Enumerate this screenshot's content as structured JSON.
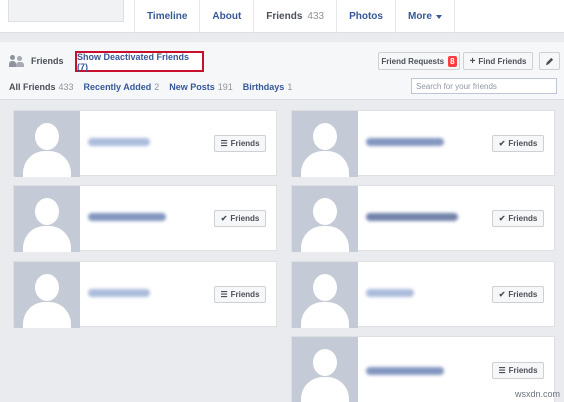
{
  "nav": {
    "tabs": [
      {
        "label": "Timeline",
        "count": ""
      },
      {
        "label": "About",
        "count": ""
      },
      {
        "label": "Friends",
        "count": "433"
      },
      {
        "label": "Photos",
        "count": ""
      },
      {
        "label": "More",
        "count": ""
      }
    ]
  },
  "header": {
    "title": "Friends",
    "deactivated_link": "Show Deactivated Friends (7)",
    "friend_requests_label": "Friend Requests",
    "friend_requests_count": "8",
    "find_friends_label": "Find Friends"
  },
  "subtabs": [
    {
      "label": "All Friends",
      "count": "433"
    },
    {
      "label": "Recently Added",
      "count": "2"
    },
    {
      "label": "New Posts",
      "count": "191"
    },
    {
      "label": "Birthdays",
      "count": "1"
    }
  ],
  "search": {
    "placeholder": "Search for your friends"
  },
  "cards": [
    {
      "button_label": "Friends",
      "button_icon": "list-icon"
    },
    {
      "button_label": "Friends",
      "button_icon": "check-icon"
    },
    {
      "button_label": "Friends",
      "button_icon": "check-icon"
    },
    {
      "button_label": "Friends",
      "button_icon": "check-icon"
    },
    {
      "button_label": "Friends",
      "button_icon": "list-icon"
    },
    {
      "button_label": "Friends",
      "button_icon": "check-icon"
    },
    {
      "button_label": "Friends",
      "button_icon": "list-icon"
    }
  ],
  "watermark": "wsxdn.com",
  "colors": {
    "link": "#365899",
    "highlight_border": "#c8102e",
    "badge": "#fa3e3e"
  }
}
